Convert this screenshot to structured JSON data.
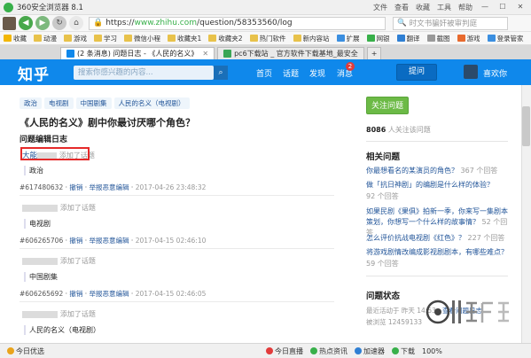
{
  "browser": {
    "title": "360安全浏览器 8.1",
    "menu": [
      "文件",
      "查看",
      "收藏",
      "工具",
      "帮助"
    ],
    "url_prefix": "https://",
    "url_host": "www.zhihu.com",
    "url_path": "/question/58353560/log",
    "search_placeholder": "时文书骗奸被审判庭",
    "bookmarks": [
      "收藏",
      "动漫",
      "游戏",
      "学习",
      "微信小程",
      "收藏夹1",
      "收藏夹2",
      "热门软件",
      "新内容站",
      "扩展",
      "网银",
      "翻译",
      "截图",
      "游戏",
      "登录管家"
    ],
    "tabs": [
      {
        "label": "(2 条消息) 问题日志 - 《人民的名义》",
        "active": true
      },
      {
        "label": "pc6下载站 _ 官方软件下载基地_最安全",
        "active": false
      }
    ],
    "status_left": "今日优选",
    "status_items": [
      "今日直播",
      "热点资讯",
      "加速器",
      "下载",
      "100%"
    ]
  },
  "zhihu": {
    "logo": "知乎",
    "search_placeholder": "搜索你感兴趣的内容...",
    "nav": [
      "首页",
      "话题",
      "发现",
      "消息"
    ],
    "message_badge": "2",
    "ask_button": "提问",
    "username": "喜欢你"
  },
  "question": {
    "topics": [
      "政治",
      "电视剧",
      "中国剧集",
      "人民的名义（电视剧）"
    ],
    "title": "《人民的名义》剧中你最讨厌哪个角色？",
    "log_title": "问题编辑日志"
  },
  "logs": [
    {
      "user": "大能",
      "action": "添加了话题",
      "topic": "政治",
      "id": "#617480632",
      "revert": "撤销",
      "report": "举报恶意编辑",
      "time": "2017-04-26 23:48:32"
    },
    {
      "user": "",
      "action": "添加了话题",
      "topic": "电视剧",
      "id": "#606265706",
      "revert": "撤销",
      "report": "举报恶意编辑",
      "time": "2017-04-15 02:46:10"
    },
    {
      "user": "",
      "action": "添加了话题",
      "topic": "中国剧集",
      "id": "#606265692",
      "revert": "撤销",
      "report": "举报恶意编辑",
      "time": "2017-04-15 02:46:05"
    },
    {
      "user": "",
      "action": "添加了话题",
      "topic": "人民的名义（电视剧）",
      "id": "",
      "revert": "",
      "report": "",
      "time": ""
    }
  ],
  "sidebar": {
    "follow_button": "关注问题",
    "follower_count": "8086",
    "follower_suffix": "人关注该问题",
    "related_title": "相关问题",
    "related": [
      {
        "q": "你最想看名的某演员的角色？",
        "count": "367 个回答"
      },
      {
        "q": "做「抗日神剧」的编剧是什么样的体验？",
        "count": "92 个回答"
      },
      {
        "q": "如果民剧《果俱》拍新一季，你来写一集剧本策划，你想写一个什么样的故事情？",
        "count": "52 个回答"
      },
      {
        "q": "怎么评价抗战电视剧《红色》？",
        "count": "227 个回答"
      },
      {
        "q": "将游戏剧情改编成影视剧剧本，有哪些难点？",
        "count": "59 个回答"
      }
    ],
    "status_title": "问题状态",
    "status_recent": "最近活动于 昨天 14:53 · ",
    "status_log_link": "查看问题日志",
    "status_views_prefix": "被浏览 ",
    "status_views": "12459133"
  }
}
